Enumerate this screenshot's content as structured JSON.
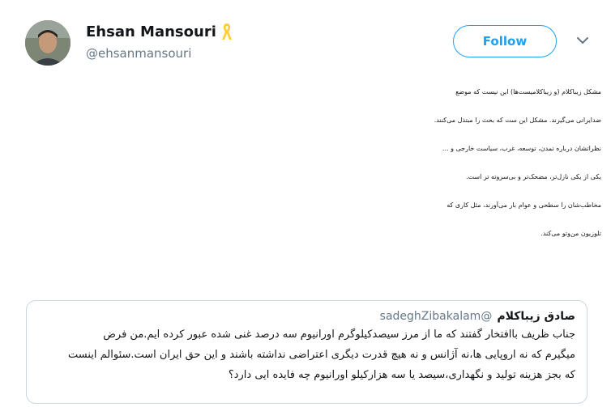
{
  "author": {
    "display_name": "Ehsan Mansouri",
    "handle": "@ehsanmansouri",
    "badge_icon": "yellow-ribbon-icon"
  },
  "actions": {
    "follow_label": "Follow",
    "more_icon": "chevron-down-icon"
  },
  "colors": {
    "accent": "#1da1f2",
    "secondary_text": "#657786",
    "border": "#ccd6dd",
    "ribbon": "#ffcc33"
  },
  "tweet": {
    "lines": [
      "مشکل زیباکلام (و زیباکلامیست‌ها) این نیست که موضع",
      "ضدایرانی می‌گیرند. مشکل این ست که بحث را مبتذل می‌کنند.",
      "نظراتشان درباره تمدن، توسعه، غرب، سیاست خارجی و ...",
      "یکی از یکی نازل‌تر، مضحک‌تر و بی‌سروته تر است.",
      "مخاطب‌شان را سطحی و عوام بار می‌آورند، مثل کاری که",
      "تلوزیون من‌وتو می‌کند."
    ]
  },
  "quoted_tweet": {
    "name": "صادق زیباکلام",
    "handle": "@sadeghZibakalam",
    "lines": [
      "جناب ظریف باافتخار گفتند که ما از مرز سیصدکیلوگرم اورانیوم سه درصد غنی شده عبور کرده ایم.من فرض",
      "میگیرم که نه اروپایی ها،نه آژانس و نه هیچ قدرت دیگری اعتراضی نداشته باشند و این حق ایران است.سئوالم اینست",
      "که بجز هزینه تولید و نگهداری،سیصد یا سه هزارکیلو اورانیوم چه فایده ایی دارد؟"
    ]
  }
}
